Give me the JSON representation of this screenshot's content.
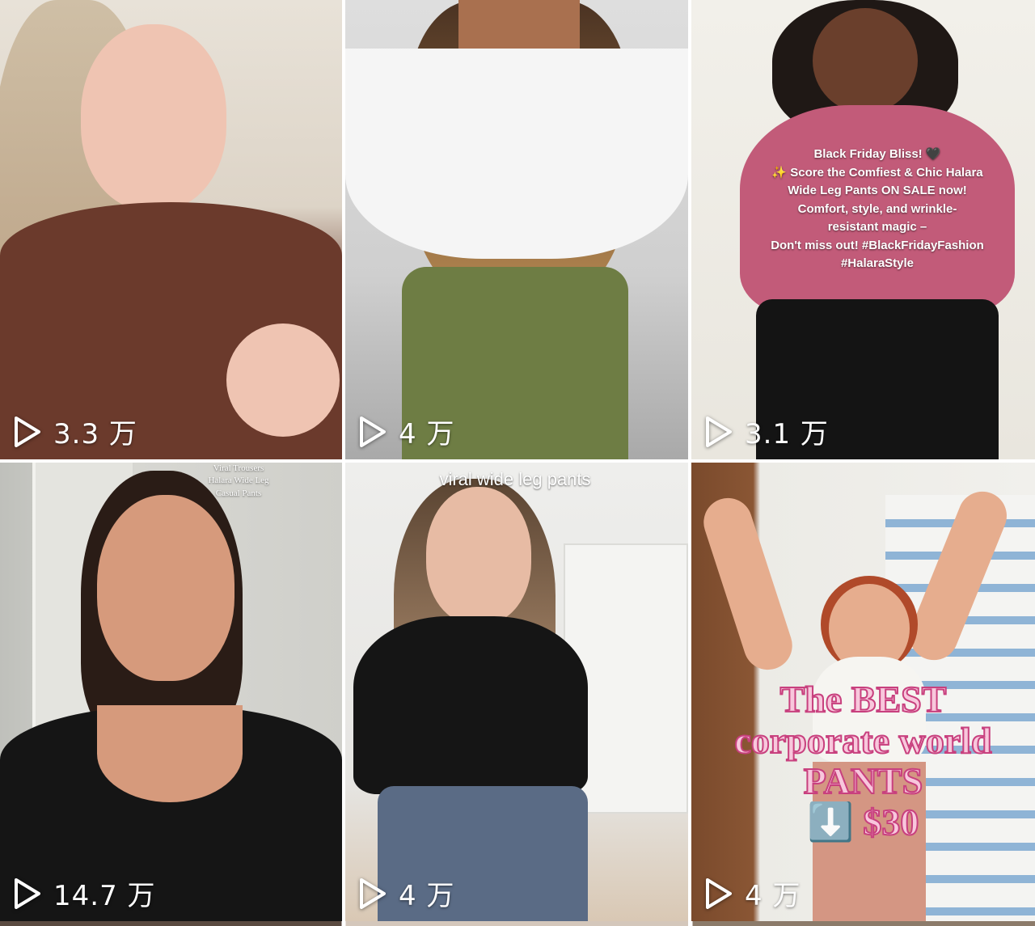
{
  "videos": [
    {
      "views": "3.3 万"
    },
    {
      "views": "4 万"
    },
    {
      "views": "3.1 万",
      "caption": "Black Friday Bliss! 🖤\n✨ Score the Comfiest & Chic Halara\nWide Leg Pants ON SALE now!\nComfort, style, and wrinkle-\nresistant magic –\nDon't miss out! #BlackFridayFashion\n#HalaraStyle"
    },
    {
      "views": "14.7 万",
      "caption_lines": [
        "Viral Trousers",
        "Halara Wide Leg",
        "Casual Pants"
      ]
    },
    {
      "views": "4 万",
      "caption": "viral wide leg pants"
    },
    {
      "views": "4 万",
      "caption_lines": [
        "The BEST",
        "corporate world",
        "PANTS",
        "⬇️ $30"
      ]
    }
  ],
  "colors": {
    "play_icon": "#ffffff",
    "caption_pink_fill": "#f8c7dc",
    "caption_pink_stroke": "#c8407e"
  },
  "icons": {
    "play": "play-icon"
  }
}
